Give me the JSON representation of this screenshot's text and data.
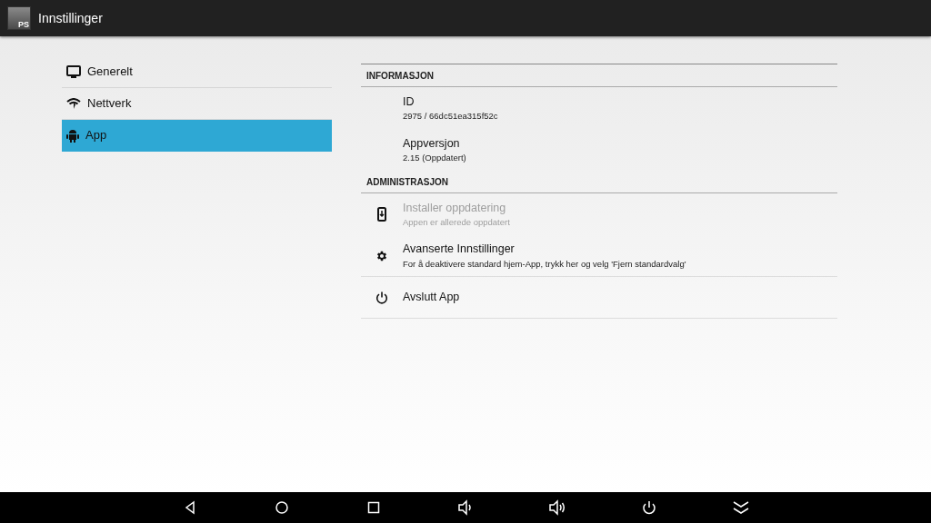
{
  "app_bar": {
    "logo_text": "PS",
    "title": "Innstillinger"
  },
  "sidebar": {
    "items": [
      {
        "label": "Generelt",
        "kind": "display",
        "selected": false
      },
      {
        "label": "Nettverk",
        "kind": "network",
        "selected": false
      },
      {
        "label": "App",
        "kind": "app",
        "selected": true
      }
    ]
  },
  "sections": [
    {
      "title": "INFORMASJON",
      "rows": [
        {
          "kind": "plain",
          "title": "ID",
          "summary": "2975 / 66dc51ea315f52c",
          "disabled": false
        },
        {
          "kind": "plain",
          "title": "Appversjon",
          "summary": "2.15 (Oppdatert)",
          "disabled": false
        }
      ]
    },
    {
      "title": "ADMINISTRASJON",
      "rows": [
        {
          "kind": "update",
          "title": "Installer oppdatering",
          "summary": "Appen er allerede oppdatert",
          "disabled": true
        },
        {
          "kind": "settings",
          "title": "Avanserte Innstillinger",
          "summary": "For å deaktivere standard hjem-App, trykk her og velg 'Fjern standardvalg'",
          "disabled": false
        },
        {
          "kind": "power",
          "title": "Avslutt App",
          "disabled": false
        }
      ]
    }
  ]
}
